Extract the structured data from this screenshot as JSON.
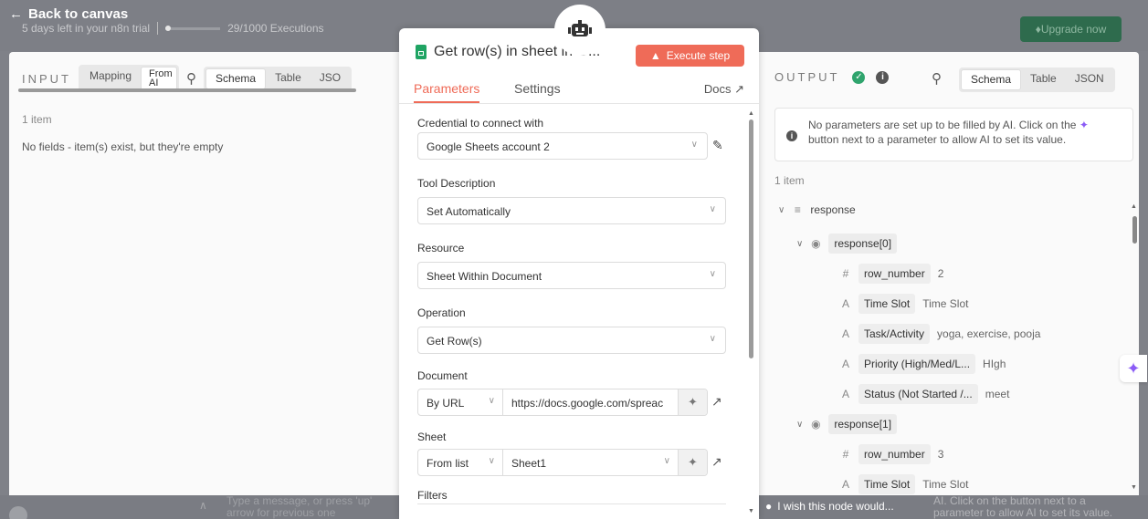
{
  "header": {
    "back_label": "Back to canvas",
    "trial_text": "5 days left in your n8n trial",
    "executions": "29/1000 Executions",
    "upgrade_label": "Upgrade now"
  },
  "input": {
    "title": "INPUT",
    "tabs": [
      "Mapping",
      "From AI"
    ],
    "views": [
      "Schema",
      "Table",
      "JSO"
    ],
    "item_count": "1 item",
    "empty_message": "No fields - item(s) exist, but they're empty"
  },
  "modal": {
    "title": "Get row(s) in sheet in G...",
    "execute_label": "Execute step",
    "tabs": {
      "parameters": "Parameters",
      "settings": "Settings",
      "docs": "Docs"
    },
    "fields": {
      "credential": {
        "label": "Credential to connect with",
        "value": "Google Sheets account 2"
      },
      "tool_description": {
        "label": "Tool Description",
        "value": "Set Automatically"
      },
      "resource": {
        "label": "Resource",
        "value": "Sheet Within Document"
      },
      "operation": {
        "label": "Operation",
        "value": "Get Row(s)"
      },
      "document": {
        "label": "Document",
        "mode": "By URL",
        "value": "https://docs.google.com/spreac"
      },
      "sheet": {
        "label": "Sheet",
        "mode": "From list",
        "value": "Sheet1"
      },
      "filters": {
        "label": "Filters"
      }
    }
  },
  "output": {
    "title": "OUTPUT",
    "views": [
      "Schema",
      "Table",
      "JSON"
    ],
    "notice": "No parameters are set up to be filled by AI. Click on the",
    "notice2": "button next to a parameter to allow AI to set its value.",
    "item_count": "1 item",
    "tree": {
      "root": "response",
      "item0": "response[0]",
      "item1": "response[1]",
      "rows0": [
        {
          "type": "#",
          "key": "row_number",
          "value": "2"
        },
        {
          "type": "A",
          "key": "Time Slot",
          "value": "Time Slot"
        },
        {
          "type": "A",
          "key": "Task/Activity",
          "value": "yoga, exercise, pooja"
        },
        {
          "type": "A",
          "key": "Priority (High/Med/L...",
          "value": "HIgh"
        },
        {
          "type": "A",
          "key": "Status (Not Started /...",
          "value": "meet"
        }
      ],
      "rows1": [
        {
          "type": "#",
          "key": "row_number",
          "value": "3"
        },
        {
          "type": "A",
          "key": "Time Slot",
          "value": "Time Slot"
        }
      ]
    }
  },
  "footer": {
    "wish": "I wish this node would...",
    "chat_hint": "Type a message, or press 'up' arrow for previous one",
    "ai_hint": "AI. Click on the button next to a parameter to allow AI to set its value."
  }
}
